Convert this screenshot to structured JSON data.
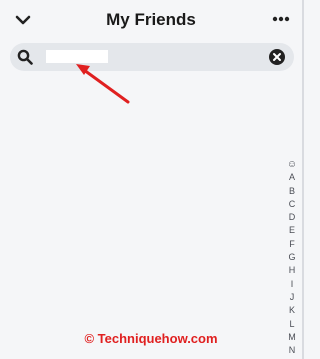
{
  "header": {
    "title": "My Friends",
    "back_icon": "chevron-down-icon",
    "more_icon": "more-horizontal-icon"
  },
  "search": {
    "value": "",
    "placeholder": "",
    "search_icon": "search-icon",
    "clear_icon": "clear-icon"
  },
  "annotation": {
    "arrow_icon": "red-arrow-icon",
    "color": "#e02020"
  },
  "index_bar": {
    "items": [
      "☺",
      "A",
      "B",
      "C",
      "D",
      "E",
      "F",
      "G",
      "H",
      "I",
      "J",
      "K",
      "L",
      "M",
      "N"
    ]
  },
  "watermark": {
    "text": "© Techniquehow.com",
    "color": "#e02020"
  },
  "colors": {
    "background": "#f5f6f8",
    "search_bar": "#e4e7eb",
    "text": "#1a1a1a"
  }
}
